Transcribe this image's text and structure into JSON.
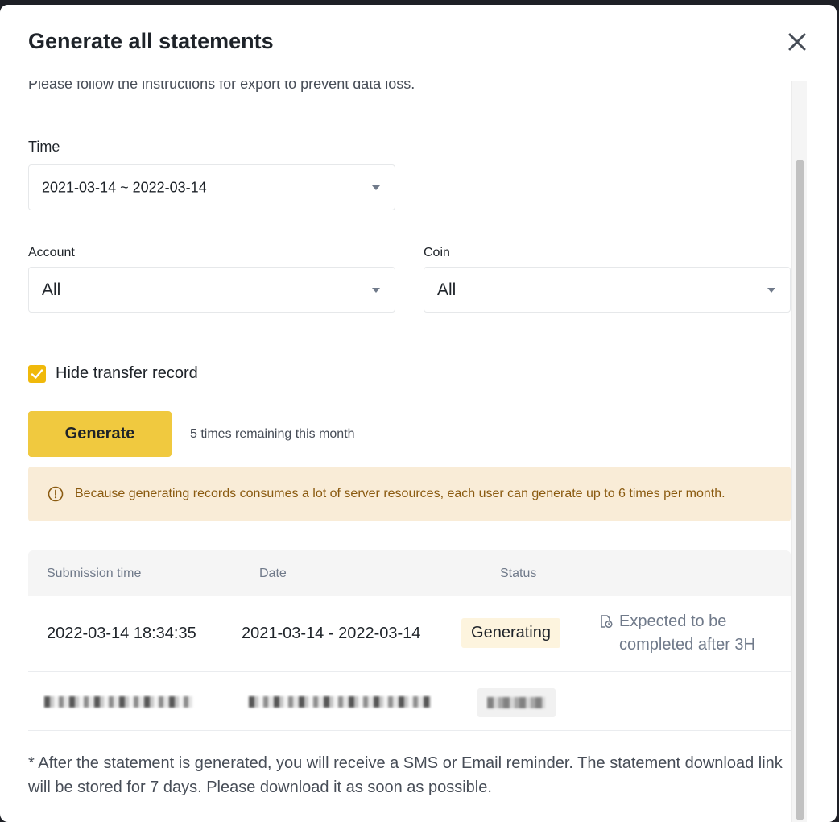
{
  "modal": {
    "title": "Generate all statements",
    "intro": "Please follow the instructions for export to prevent data loss."
  },
  "form": {
    "time_label": "Time",
    "time_value": "2021-03-14 ~ 2022-03-14",
    "account_label": "Account",
    "account_value": "All",
    "coin_label": "Coin",
    "coin_value": "All",
    "hide_transfer_label": "Hide transfer record",
    "hide_transfer_checked": true,
    "generate_label": "Generate",
    "remaining_text": "5 times remaining this month"
  },
  "notice": {
    "text": "Because generating records consumes a lot of server resources, each user can generate up to 6 times per month."
  },
  "table": {
    "headers": [
      "Submission time",
      "Date",
      "Status"
    ],
    "rows": [
      {
        "submission_time": "2022-03-14 18:34:35",
        "date": "2021-03-14 - 2022-03-14",
        "status": "Generating",
        "expected": "Expected to be completed after 3H"
      }
    ]
  },
  "footnote": "* After the statement is generated, you will receive a SMS or Email reminder. The statement download link will be stored for 7 days. Please download it as soon as possible.",
  "colors": {
    "accent": "#f0b90b",
    "button": "#f0c93f",
    "notice_bg": "#f9ecd7",
    "notice_text": "#8a5a10",
    "badge_bg": "#fdf4de"
  }
}
